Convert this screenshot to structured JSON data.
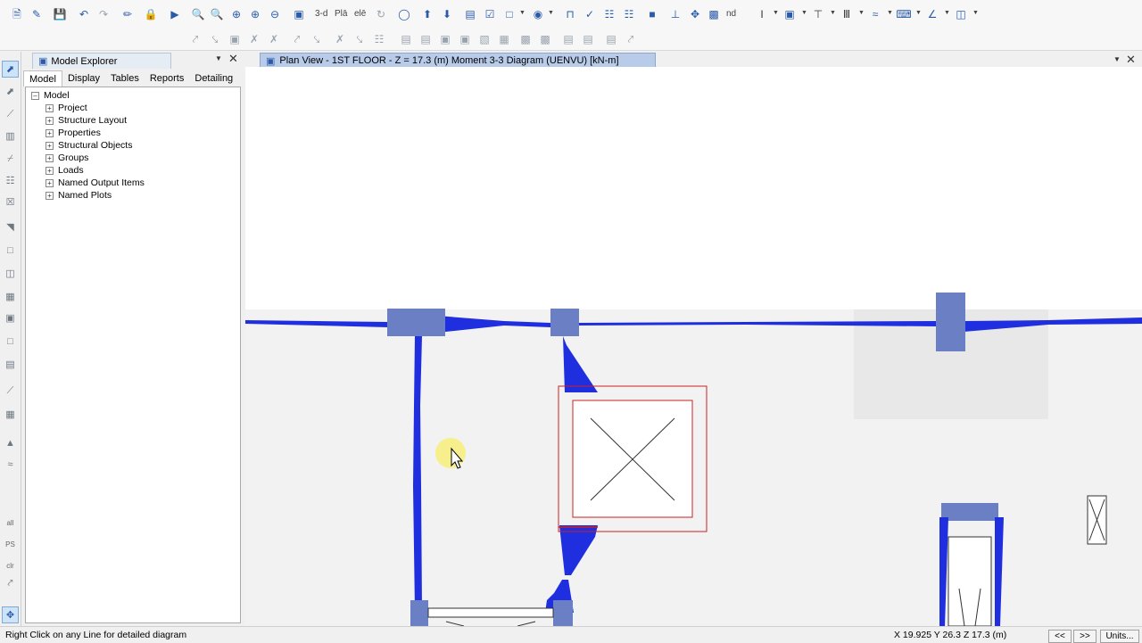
{
  "toolbar_main": {
    "view_3d_label": "3-d",
    "view_plan_label": "Plā",
    "view_elev_label": "elē",
    "nd_label": "nd"
  },
  "model_explorer": {
    "title": "Model Explorer",
    "tabs": [
      {
        "label": "Model"
      },
      {
        "label": "Display"
      },
      {
        "label": "Tables"
      },
      {
        "label": "Reports"
      },
      {
        "label": "Detailing"
      }
    ],
    "tree_root": "Model",
    "tree_items": [
      {
        "label": "Project"
      },
      {
        "label": "Structure Layout"
      },
      {
        "label": "Properties"
      },
      {
        "label": "Structural Objects"
      },
      {
        "label": "Groups"
      },
      {
        "label": "Loads"
      },
      {
        "label": "Named Output Items"
      },
      {
        "label": "Named Plots"
      }
    ]
  },
  "view_window": {
    "title": "Plan View - 1ST FLOOR - Z = 17.3 (m)    Moment 3-3 Diagram    (UENVU)  [kN-m]"
  },
  "left_toolbar": {
    "label_all": "all",
    "label_ps": "PS",
    "label_clr": "clr"
  },
  "status": {
    "hint": "Right Click on any Line for detailed diagram",
    "coordinates": "X 19.925  Y 26.3  Z 17.3 (m)",
    "prev_label": "<<",
    "next_label": ">>",
    "units_label": "Units..."
  },
  "colors": {
    "diagram_fill": "#1f2fe0",
    "column_fill": "#6b7fc4",
    "highlight_red": "#cc2222",
    "tab_active": "#b8cbe8"
  }
}
